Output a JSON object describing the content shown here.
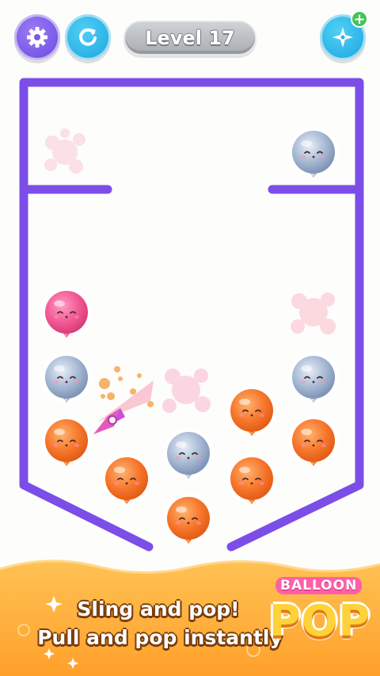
{
  "hud": {
    "level_label": "Level 17",
    "settings_icon": "gear-icon",
    "restart_icon": "restart-icon",
    "shuriken_icon": "shuriken-icon",
    "plus_badge": "+"
  },
  "colors": {
    "wall": "#7b4ee8",
    "orange_balloon": "#f7772c",
    "blue_balloon": "#9eb2cf",
    "pink_balloon": "#f25a95",
    "banner": "#ffaf3a"
  },
  "balloons": [
    {
      "color": "blue"
    },
    {
      "color": "pink"
    },
    {
      "color": "blue"
    },
    {
      "color": "blue"
    },
    {
      "color": "orange"
    },
    {
      "color": "orange"
    },
    {
      "color": "orange"
    },
    {
      "color": "orange"
    },
    {
      "color": "blue"
    },
    {
      "color": "orange"
    },
    {
      "color": "orange"
    }
  ],
  "banner": {
    "line1": "Sling and pop!",
    "line2": "Pull and pop instantly",
    "logo_top": "BALLOON",
    "logo_word": "POP"
  }
}
